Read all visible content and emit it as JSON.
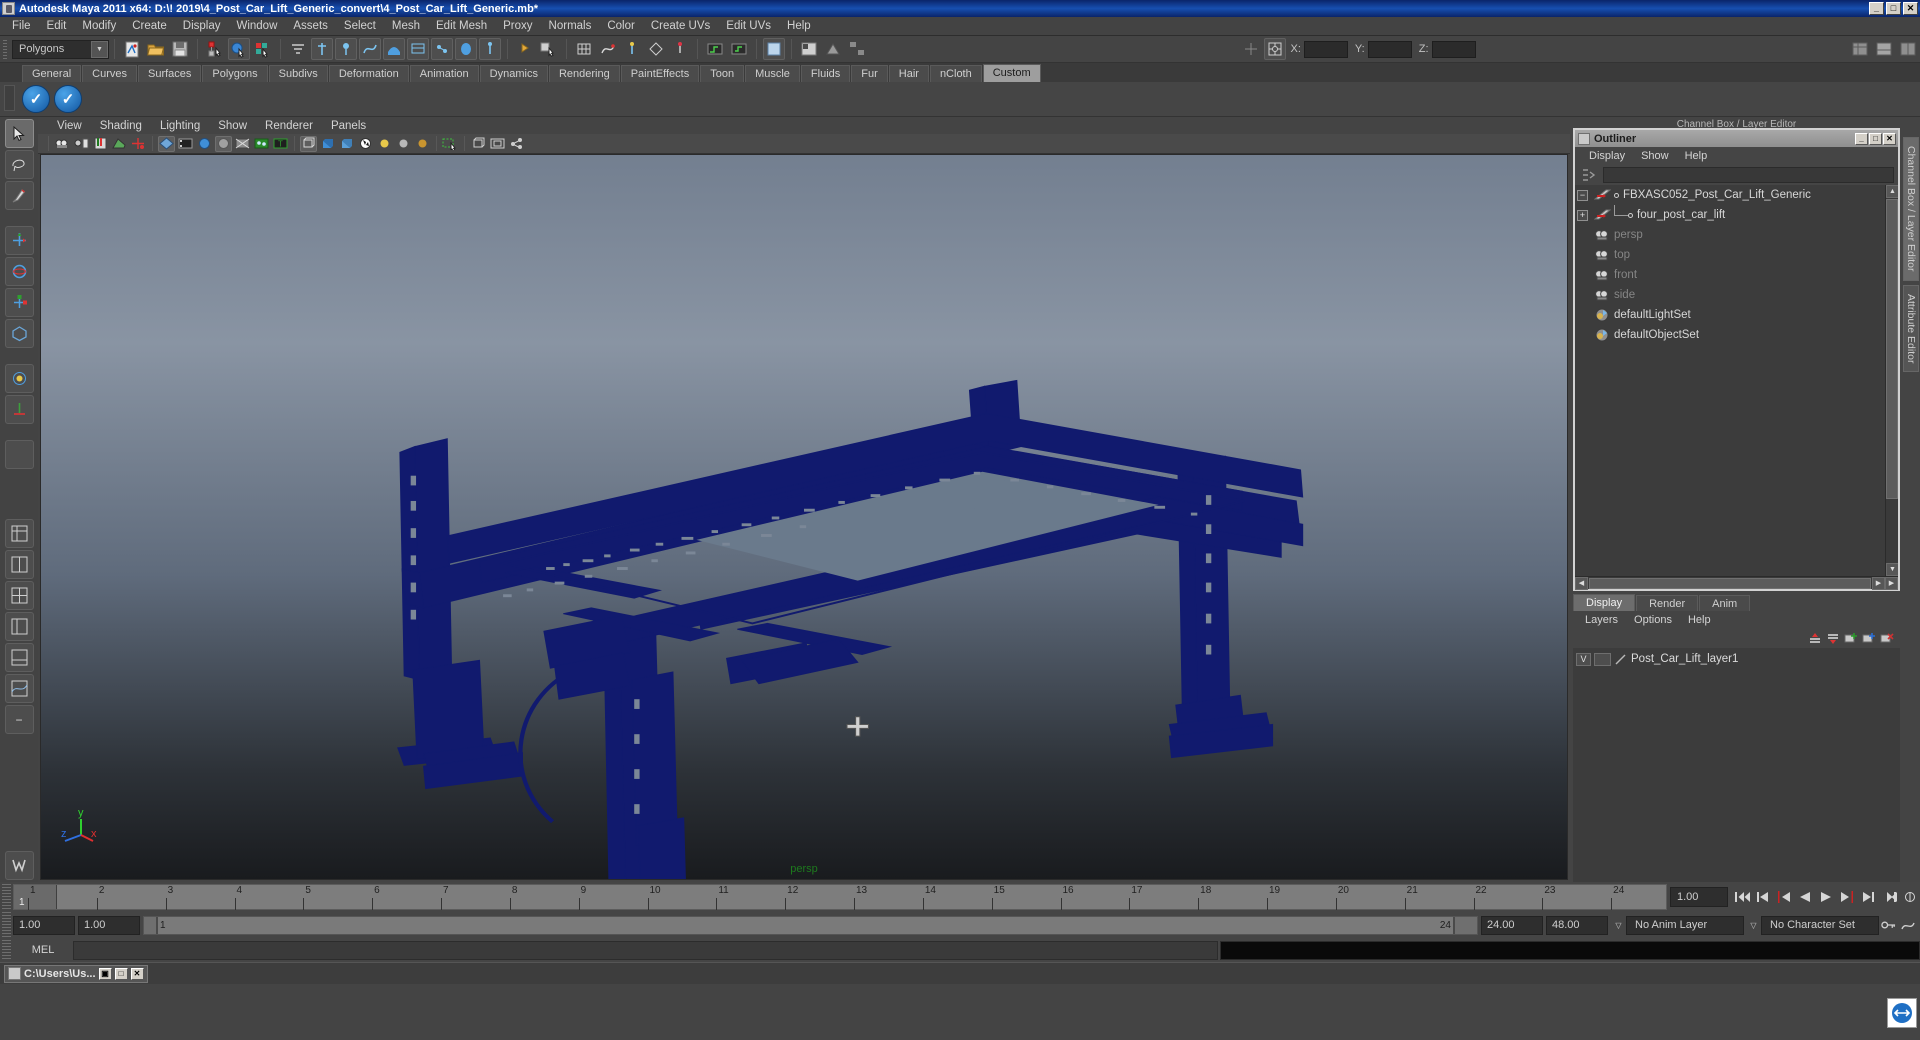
{
  "window": {
    "title": "Autodesk Maya 2011 x64: D:\\! 2019\\4_Post_Car_Lift_Generic_convert\\4_Post_Car_Lift_Generic.mb*",
    "minimize": "_",
    "maximize": "□",
    "close": "✕"
  },
  "menubar": {
    "items": [
      "File",
      "Edit",
      "Modify",
      "Create",
      "Display",
      "Window",
      "Assets",
      "Select",
      "Mesh",
      "Edit Mesh",
      "Proxy",
      "Normals",
      "Color",
      "Create UVs",
      "Edit UVs",
      "Help"
    ]
  },
  "toolbar": {
    "menuset": "Polygons",
    "axis_x_label": "X:",
    "axis_y_label": "Y:",
    "axis_z_label": "Z:",
    "axis_x_value": "",
    "axis_y_value": "",
    "axis_z_value": ""
  },
  "shelf": {
    "tabs": [
      "General",
      "Curves",
      "Surfaces",
      "Polygons",
      "Subdivs",
      "Deformation",
      "Animation",
      "Dynamics",
      "Rendering",
      "PaintEffects",
      "Toon",
      "Muscle",
      "Fluids",
      "Fur",
      "Hair",
      "nCloth",
      "Custom"
    ],
    "active_tab": "Custom",
    "buttons": [
      "check-mark-1",
      "check-mark-2"
    ]
  },
  "viewport": {
    "menus": [
      "View",
      "Shading",
      "Lighting",
      "Show",
      "Renderer",
      "Panels"
    ],
    "camera_label": "persp",
    "axis_x": "x",
    "axis_y": "y",
    "axis_z": "z",
    "background_top": "#8994a3",
    "background_bottom": "#191b1e",
    "model_color": "#111a6e",
    "model_name": "four_post_car_lift"
  },
  "outliner": {
    "title": "Outliner",
    "menus": [
      "Display",
      "Show",
      "Help"
    ],
    "search_value": "",
    "items": [
      {
        "label": "FBXASC052_Post_Car_Lift_Generic",
        "expander": "−",
        "icon": "transform-icon",
        "dimmed": false,
        "indent": 0
      },
      {
        "label": "four_post_car_lift",
        "expander": "+",
        "icon": "transform-icon",
        "dimmed": false,
        "indent": 1
      },
      {
        "label": "persp",
        "expander": "",
        "icon": "camera-icon",
        "dimmed": true,
        "indent": 0
      },
      {
        "label": "top",
        "expander": "",
        "icon": "camera-icon",
        "dimmed": true,
        "indent": 0
      },
      {
        "label": "front",
        "expander": "",
        "icon": "camera-icon",
        "dimmed": true,
        "indent": 0
      },
      {
        "label": "side",
        "expander": "",
        "icon": "camera-icon",
        "dimmed": true,
        "indent": 0
      },
      {
        "label": "defaultLightSet",
        "expander": "",
        "icon": "set-icon",
        "dimmed": false,
        "indent": 0
      },
      {
        "label": "defaultObjectSet",
        "expander": "",
        "icon": "set-icon",
        "dimmed": false,
        "indent": 0
      }
    ]
  },
  "layer_editor": {
    "tabs": [
      "Display",
      "Render",
      "Anim"
    ],
    "active_tab": "Display",
    "menus": [
      "Layers",
      "Options",
      "Help"
    ],
    "layers": [
      {
        "visibility": "V",
        "playback": "",
        "name": "Post_Car_Lift_layer1"
      }
    ]
  },
  "right_tabs": {
    "items": [
      "Channel Box / Layer Editor",
      "Attribute Editor"
    ],
    "active": "Channel Box / Layer Editor",
    "hint": "Channel Box / Layer Editor"
  },
  "time_slider": {
    "ticks": [
      "1",
      "2",
      "3",
      "4",
      "5",
      "6",
      "7",
      "8",
      "9",
      "10",
      "11",
      "12",
      "13",
      "14",
      "15",
      "16",
      "17",
      "18",
      "19",
      "20",
      "21",
      "22",
      "23",
      "24"
    ],
    "current_frame": "1",
    "current_field": "1.00",
    "playback_buttons": [
      "go-to-start",
      "step-back-key",
      "step-back-frame",
      "play-backwards",
      "play-forwards",
      "step-forward-frame",
      "step-forward-key",
      "go-to-end"
    ]
  },
  "range_slider": {
    "anim_start": "1.00",
    "anim_end": "1.00",
    "range_start": "1",
    "range_end": "24",
    "playback_end": "24.00",
    "anim_end_total": "48.00",
    "anim_layer": "No Anim Layer",
    "character_set": "No Character Set"
  },
  "command_line": {
    "label": "MEL",
    "input_value": "",
    "output_value": ""
  },
  "taskbar": {
    "item_label": "C:\\Users\\Us...",
    "restore": "▣",
    "maximize": "□",
    "close": "✕"
  }
}
